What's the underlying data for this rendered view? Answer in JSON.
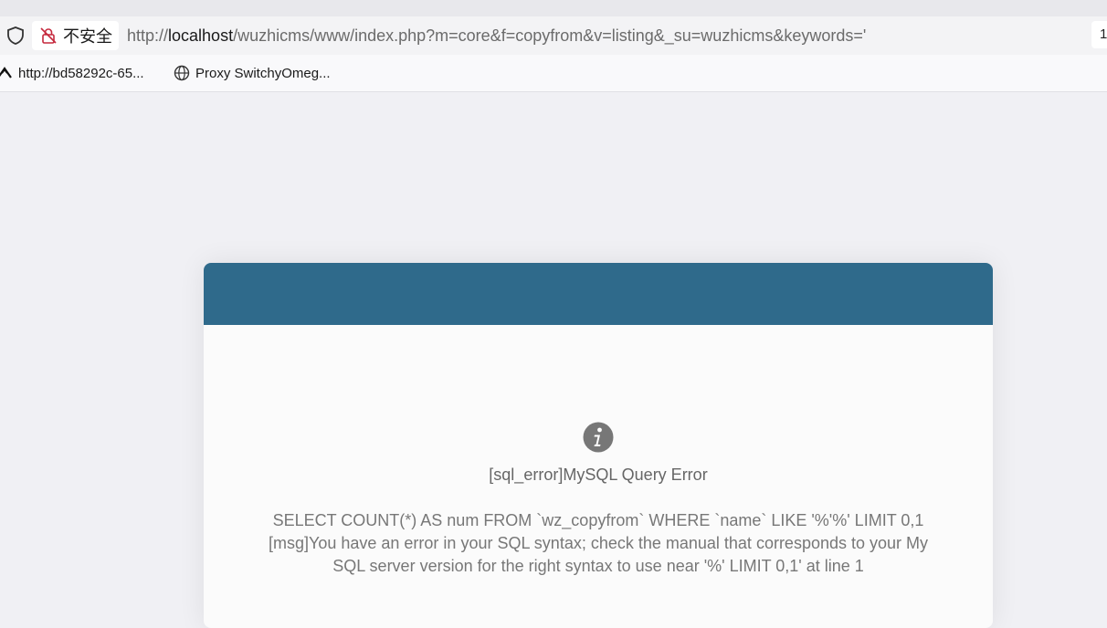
{
  "browser": {
    "security_label": "不安全",
    "url_prefix": "http://",
    "url_host": "localhost",
    "url_rest": "/wuzhicms/www/index.php?m=core&f=copyfrom&v=listing&_su=wuzhicms&keywords='",
    "right_badge": "1"
  },
  "bookmarks": [
    {
      "label": "http://bd58292c-65...",
      "icon": "arrow-icon"
    },
    {
      "label": "Proxy SwitchyOmeg...",
      "icon": "globe-icon"
    }
  ],
  "error": {
    "title": "[sql_error]MySQL Query Error",
    "line1": "SELECT COUNT(*) AS num FROM `wz_copyfrom` WHERE `name` LIKE '%'%' LIMIT 0,1",
    "line2": "[msg]You have an error in your SQL syntax; check the manual that corresponds to your My",
    "line3": "SQL server version for the right syntax to use near '%' LIMIT 0,1' at line 1"
  },
  "colors": {
    "header": "#2f6a8b",
    "info_icon": "#777777"
  }
}
